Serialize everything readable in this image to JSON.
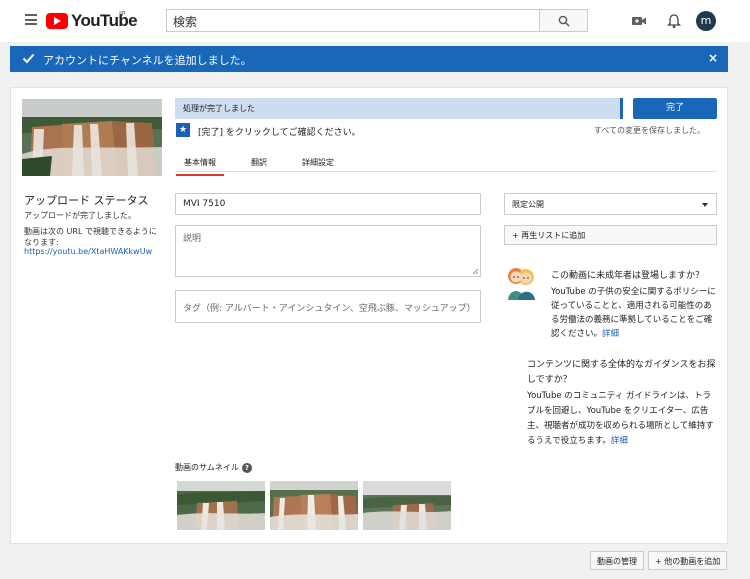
{
  "header": {
    "logo_text": "YouTube",
    "region": "JP",
    "search_placeholder": "検索",
    "avatar_initial": "m"
  },
  "banner": {
    "message": "アカウントにチャンネルを追加しました。",
    "close": "×",
    "color": "#1967b9"
  },
  "sidebar": {
    "status_title": "アップロード ステータス",
    "status_done": "アップロードが完了しました。",
    "url_label": "動画は次の URL で視聴できるようになります:",
    "url": "https://youtu.be/XtaHWAKkwUw"
  },
  "progress": {
    "text": "処理が完了しました",
    "done_button": "完了",
    "hint": "[完了] をクリックしてご確認ください。",
    "saved": "すべての変更を保存しました。"
  },
  "tabs": [
    {
      "label": "基本情報",
      "active": true
    },
    {
      "label": "翻訳",
      "active": false
    },
    {
      "label": "詳細設定",
      "active": false
    }
  ],
  "form": {
    "title_value": "MVI 7510",
    "description_placeholder": "説明",
    "tags_placeholder": "タグ（例: アルバート・アインシュタイン、空飛ぶ豚、マッシュアップ）",
    "privacy_value": "限定公開",
    "playlist_button": "+ 再生リストに追加"
  },
  "kids": {
    "question": "この動画に未成年者は登場しますか？",
    "body": "YouTube の子供の安全に関するポリシーに従っていることと、適用される可能性のある労働法の義務に準拠していることをご確認ください。",
    "link": "詳細"
  },
  "guidance": {
    "question": "コンテンツに関する全体的なガイダンスをお探しですか？",
    "body": "YouTube のコミュニティ ガイドラインは、トラブルを回避し、YouTube をクリエイター、広告主、視聴者が成功を収められる場所として維持するうえで役立ちます。",
    "link": "詳細"
  },
  "thumbnails": {
    "label": "動画のサムネイル",
    "help": "?"
  },
  "footer": {
    "manage": "動画の管理",
    "add_more": "+ 他の動画を追加"
  }
}
